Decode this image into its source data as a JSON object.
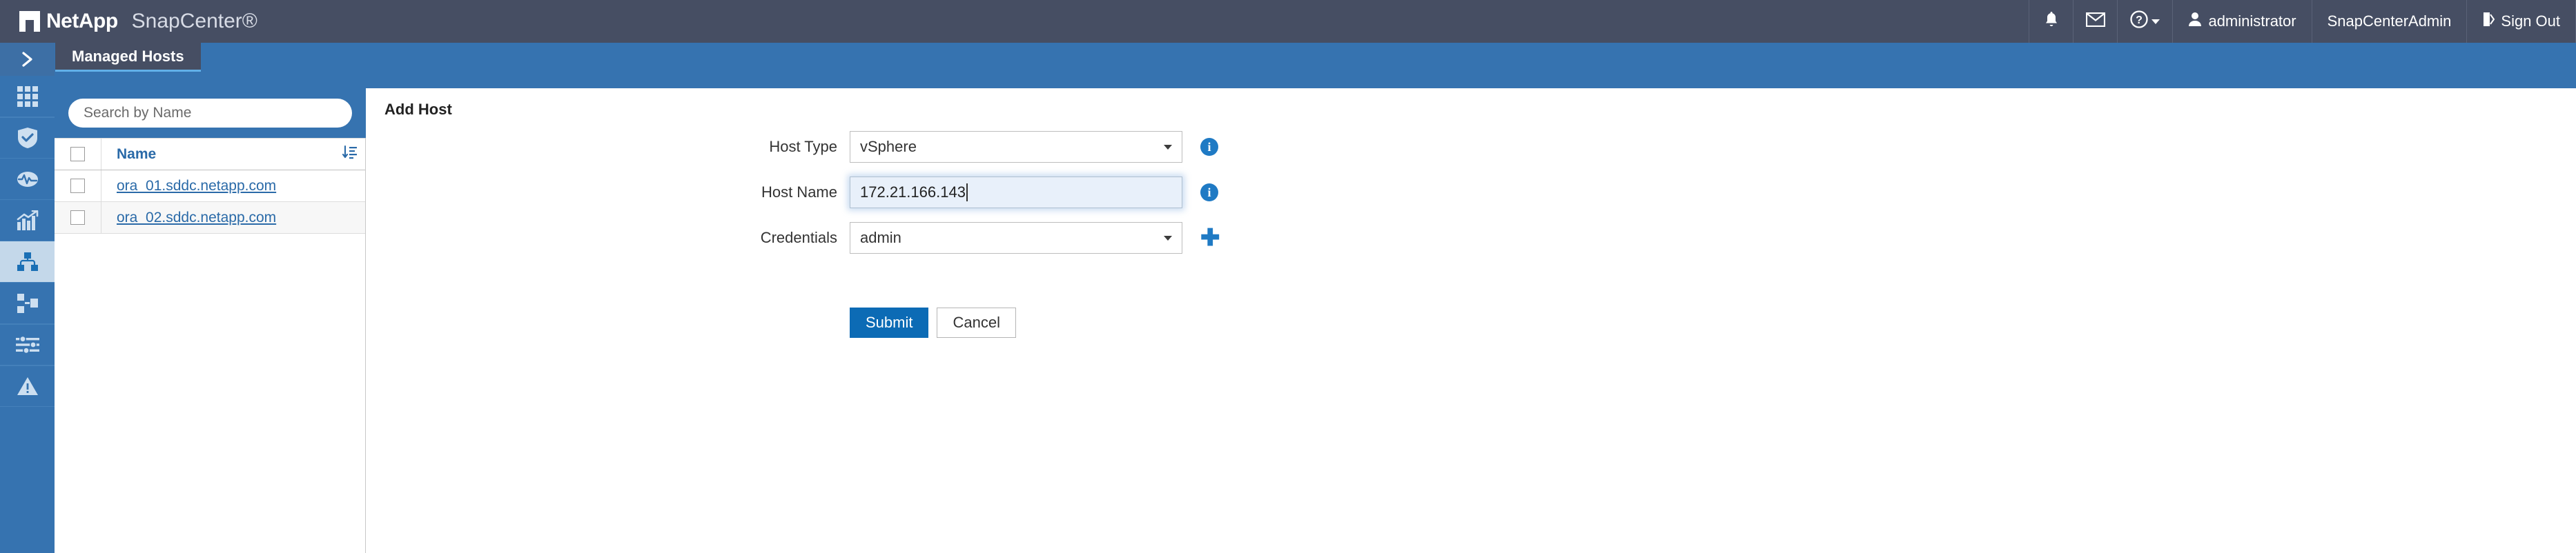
{
  "header": {
    "brand_name": "NetApp",
    "product_name": "SnapCenter®",
    "logo_icon": "netapp-logo-icon",
    "right_items": [
      {
        "icon": "bell-icon",
        "label": ""
      },
      {
        "icon": "envelope-icon",
        "label": ""
      },
      {
        "icon": "help-circle-icon",
        "label": ""
      },
      {
        "icon": "user-icon",
        "label": "administrator"
      },
      {
        "icon": "",
        "label": "SnapCenterAdmin"
      },
      {
        "icon": "sign-out-icon",
        "label": "Sign Out"
      }
    ]
  },
  "sidebar": {
    "items": [
      {
        "icon": "chevron-right-expand-icon",
        "label": "Expand",
        "active": false
      },
      {
        "icon": "dashboard-grid-icon",
        "label": "Dashboard",
        "active": false
      },
      {
        "icon": "shield-check-icon",
        "label": "Resources",
        "active": false
      },
      {
        "icon": "monitor-pulse-icon",
        "label": "Monitor",
        "active": false
      },
      {
        "icon": "bar-chart-trend-icon",
        "label": "Reports",
        "active": false
      },
      {
        "icon": "hosts-network-icon",
        "label": "Hosts",
        "active": true
      },
      {
        "icon": "storage-systems-icon",
        "label": "Storage Systems",
        "active": false
      },
      {
        "icon": "sliders-settings-icon",
        "label": "Settings",
        "active": false
      },
      {
        "icon": "alert-triangle-icon",
        "label": "Alerts",
        "active": false
      }
    ]
  },
  "left_panel": {
    "tab_label": "Managed Hosts",
    "search": {
      "placeholder": "Search by Name",
      "value": "",
      "icon": "search-icon"
    },
    "table": {
      "select_all_icon": "checkbox-icon",
      "sort_icon": "sort-descending-icon",
      "columns": [
        "Name"
      ],
      "rows": [
        {
          "checkbox": "unchecked",
          "name": "ora_01.sddc.netapp.com"
        },
        {
          "checkbox": "unchecked",
          "name": "ora_02.sddc.netapp.com"
        }
      ]
    }
  },
  "main": {
    "title": "Add Host",
    "fields": [
      {
        "label": "Host Type",
        "value": "vSphere",
        "control": "select",
        "caret_icon": "chevron-down-icon",
        "adornment": "info-icon"
      },
      {
        "label": "Host Name",
        "value": "172.21.166.143",
        "control": "text",
        "focused": true,
        "adornment": "info-icon"
      },
      {
        "label": "Credentials",
        "value": "admin",
        "control": "select",
        "caret_icon": "chevron-down-icon",
        "adornment": "plus-icon"
      }
    ],
    "buttons": {
      "submit_label": "Submit",
      "cancel_label": "Cancel"
    }
  },
  "colors": {
    "header_bg": "#464e63",
    "band_blue": "#3673b0",
    "accent_blue": "#0c6bb5",
    "link_blue": "#2a6aa8",
    "active_rail": "#c4d8ea",
    "focus_field": "#e8f0fa"
  }
}
